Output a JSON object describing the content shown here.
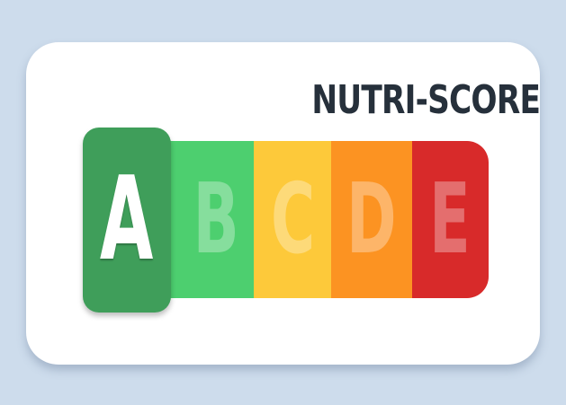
{
  "title": "NUTRI-SCORE",
  "active_grade": "A",
  "grades": [
    {
      "letter": "A",
      "color": "#4dcf6f"
    },
    {
      "letter": "B",
      "color": "#4dcf6f"
    },
    {
      "letter": "C",
      "color": "#fdc93a"
    },
    {
      "letter": "D",
      "color": "#fc9322"
    },
    {
      "letter": "E",
      "color": "#d82a2a"
    }
  ],
  "colors": {
    "background": "#cddcec",
    "card": "#ffffff",
    "title_text": "#26303b",
    "active_badge": "#3f9e5a",
    "active_letter": "#ffffff",
    "inactive_letter": "rgba(255,255,255,0.32)"
  }
}
